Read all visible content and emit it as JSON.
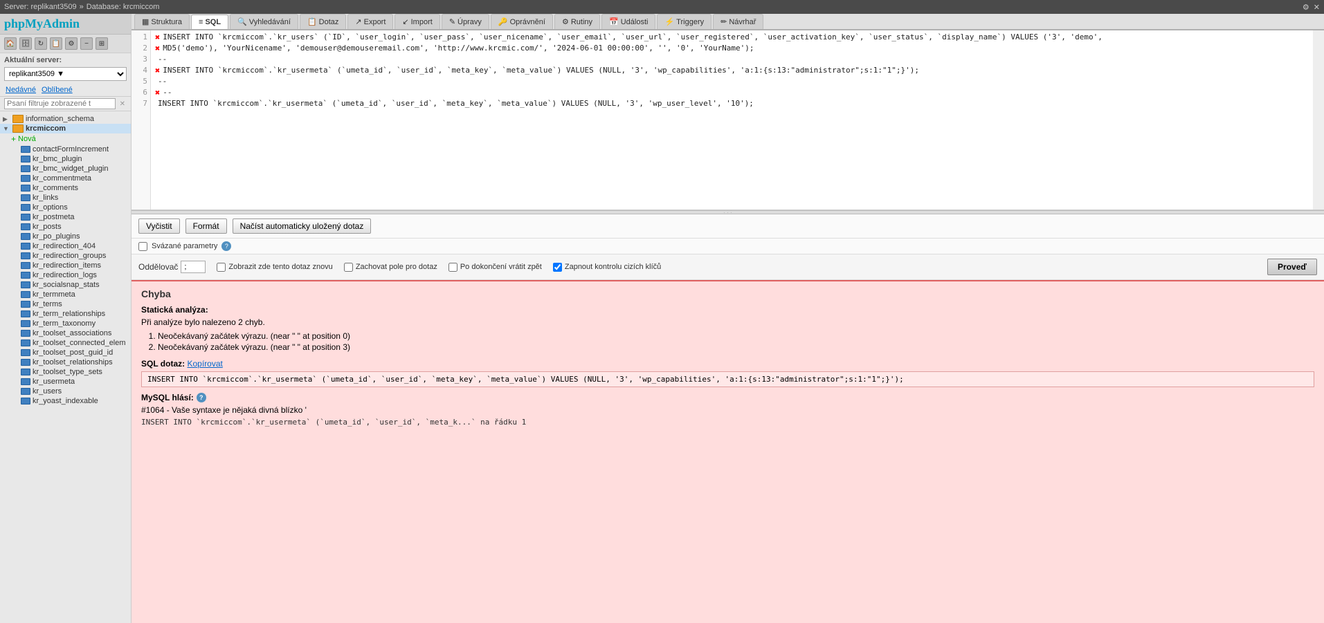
{
  "topbar": {
    "breadcrumb_server": "Server: replikant3509",
    "breadcrumb_sep": "»",
    "breadcrumb_db": "Database: krcmiccom",
    "settings_icon": "⚙",
    "exit_icon": "✕"
  },
  "sidebar": {
    "logo_php": "php",
    "logo_myadmin": "MyAdmin",
    "icon_home": "🏠",
    "icon_refresh": "↻",
    "icon_plus": "+",
    "icon_star": "★",
    "icon_gear": "⚙",
    "icon_minus": "−",
    "icon_expand": "⊞",
    "server_label": "Aktuální server:",
    "server_value": "replikant3509",
    "server_arrow": "▼",
    "tab_nedavne": "Nedávné",
    "tab_oblibene": "Oblíbené",
    "filter_placeholder": "Psaní filtruje zobrazené t",
    "filter_clear": "✕",
    "databases": [
      {
        "name": "information_schema",
        "expanded": false,
        "level": 0
      },
      {
        "name": "krcmiccom",
        "expanded": true,
        "level": 0,
        "active": true
      },
      {
        "name": "Nová",
        "isNew": true,
        "level": 1
      },
      {
        "name": "contactFormIncrement",
        "level": 1
      },
      {
        "name": "kr_bmc_plugin",
        "level": 1
      },
      {
        "name": "kr_bmc_widget_plugin",
        "level": 1
      },
      {
        "name": "kr_commentmeta",
        "level": 1
      },
      {
        "name": "kr_comments",
        "level": 1
      },
      {
        "name": "kr_links",
        "level": 1
      },
      {
        "name": "kr_options",
        "level": 1
      },
      {
        "name": "kr_postmeta",
        "level": 1
      },
      {
        "name": "kr_posts",
        "level": 1
      },
      {
        "name": "kr_po_plugins",
        "level": 1
      },
      {
        "name": "kr_redirection_404",
        "level": 1
      },
      {
        "name": "kr_redirection_groups",
        "level": 1
      },
      {
        "name": "kr_redirection_items",
        "level": 1
      },
      {
        "name": "kr_redirection_logs",
        "level": 1
      },
      {
        "name": "kr_socialsnap_stats",
        "level": 1
      },
      {
        "name": "kr_termmeta",
        "level": 1
      },
      {
        "name": "kr_terms",
        "level": 1
      },
      {
        "name": "kr_term_relationships",
        "level": 1
      },
      {
        "name": "kr_term_taxonomy",
        "level": 1
      },
      {
        "name": "kr_toolset_associations",
        "level": 1
      },
      {
        "name": "kr_toolset_connected_elem",
        "level": 1
      },
      {
        "name": "kr_toolset_post_guid_id",
        "level": 1
      },
      {
        "name": "kr_toolset_relationships",
        "level": 1
      },
      {
        "name": "kr_toolset_type_sets",
        "level": 1
      },
      {
        "name": "kr_usermeta",
        "level": 1
      },
      {
        "name": "kr_users",
        "level": 1
      },
      {
        "name": "kr_yoast_indexable",
        "level": 1
      }
    ]
  },
  "tabs": [
    {
      "id": "struktura",
      "label": "Struktura",
      "icon": "▦"
    },
    {
      "id": "sql",
      "label": "SQL",
      "icon": "≡",
      "active": true
    },
    {
      "id": "vyhledavani",
      "label": "Vyhledávání",
      "icon": "🔍"
    },
    {
      "id": "dotaz",
      "label": "Dotaz",
      "icon": "📋"
    },
    {
      "id": "export",
      "label": "Export",
      "icon": "↗"
    },
    {
      "id": "import",
      "label": "Import",
      "icon": "↙"
    },
    {
      "id": "upravy",
      "label": "Úpravy",
      "icon": "✎"
    },
    {
      "id": "opravneni",
      "label": "Oprávnění",
      "icon": "🔑"
    },
    {
      "id": "rutiny",
      "label": "Rutiny",
      "icon": "⚙"
    },
    {
      "id": "udalosti",
      "label": "Události",
      "icon": "📅"
    },
    {
      "id": "triggery",
      "label": "Triggery",
      "icon": "⚡"
    },
    {
      "id": "navrhar",
      "label": "Návrhař",
      "icon": "✏"
    }
  ],
  "sql_lines": [
    {
      "num": 1,
      "error": true,
      "code": "INSERT INTO `krcmiccom`.`kr_users` (`ID`, `user_login`, `user_pass`, `user_nicename`, `user_email`, `user_url`, `user_registered`, `user_activation_key`, `user_status`, `display_name`) VALUES ('3', 'demo',"
    },
    {
      "num": 2,
      "error": true,
      "code": "MD5('demo'), 'YourNicename', 'demouser@demouseremail.com', 'http://www.krcmic.com/', '2024-06-01 00:00:00', '', '0', 'YourName');"
    },
    {
      "num": 3,
      "error": false,
      "code": "--"
    },
    {
      "num": 4,
      "error": true,
      "code": "INSERT INTO `krcmiccom`.`kr_usermeta` (`umeta_id`, `user_id`, `meta_key`, `meta_value`) VALUES (NULL, '3', 'wp_capabilities', 'a:1:{s:13:\"administrator\";s:1:\"1\";}');"
    },
    {
      "num": 5,
      "error": false,
      "code": "--"
    },
    {
      "num": 6,
      "error": true,
      "code": "--"
    },
    {
      "num": 7,
      "error": false,
      "code": "INSERT INTO `krcmiccom`.`kr_usermeta` (`umeta_id`, `user_id`, `meta_key`, `meta_value`) VALUES (NULL, '3', 'wp_user_level', '10');"
    }
  ],
  "buttons": {
    "vycistit": "Vyčistit",
    "format": "Formát",
    "nacist": "Načíst automaticky uložený dotaz"
  },
  "params": {
    "svazane_label": "Svázané parametry",
    "checked": false
  },
  "options": {
    "oddelovac_label": "Oddělovač",
    "oddelovac_value": ";",
    "checkbox1_label": "Zobrazit zde tento dotaz znovu",
    "checkbox1_checked": false,
    "checkbox2_label": "Zachovat pole pro dotaz",
    "checkbox2_checked": false,
    "checkbox3_label": "Po dokončení vrátit zpět",
    "checkbox3_checked": false,
    "checkbox4_label": "Zapnout kontrolu cizích klíčů",
    "checkbox4_checked": true,
    "provest_label": "Proveď"
  },
  "error": {
    "title": "Chyba",
    "static_analysis": "Statická analýza:",
    "found_text": "Při analýze bylo nalezeno 2 chyb.",
    "errors": [
      "Neočekávaný začátek výrazu. (near \" \" at position 0)",
      "Neočekávaný začátek výrazu. (near \" \" at position 3)"
    ],
    "sql_dotaz_label": "SQL dotaz:",
    "copy_link": "Kopírovat",
    "sql_query_text": "INSERT INTO `krcmiccom`.`kr_usermeta` (`umeta_id`, `user_id`, `meta_key`, `meta_value`) VALUES (NULL, '3', 'wp_capabilities', 'a:1:{s:13:\"administrator\";s:1:\"1\";}');",
    "mysql_says": "MySQL hlásí:",
    "error_number": "#1064 - Vaše syntaxe je nějaká divná blízko '",
    "error_query": "INSERT INTO `krcmiccom`.`kr_usermeta` (`umeta_id`, `user_id`, `meta_k...` na řádku 1"
  }
}
